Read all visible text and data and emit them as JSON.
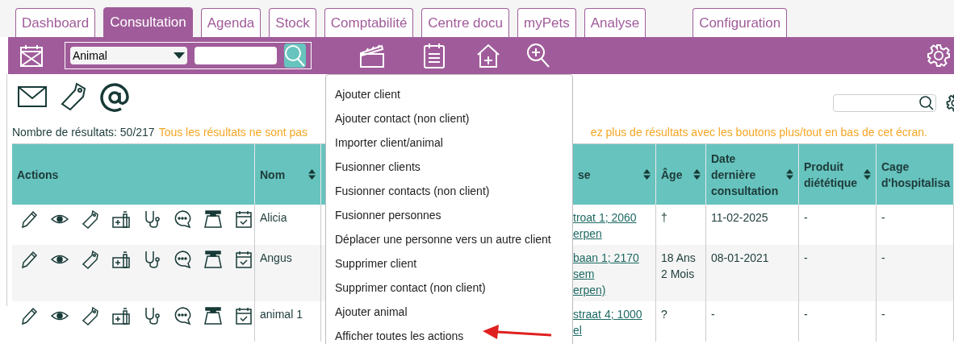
{
  "tabs": [
    {
      "label": "Dashboard",
      "selected": false
    },
    {
      "label": "Consultation",
      "selected": true
    },
    {
      "label": "Agenda",
      "selected": false
    },
    {
      "label": "Stock",
      "selected": false
    },
    {
      "label": "Comptabilité",
      "selected": false
    },
    {
      "label": "Centre docu",
      "selected": false
    },
    {
      "label": "myPets",
      "selected": false
    },
    {
      "label": "Analyse",
      "selected": false
    },
    {
      "label": "Configuration",
      "selected": false
    }
  ],
  "toolbar": {
    "search_type": "Animal"
  },
  "results": {
    "count": "Nombre de résultats: 50/217",
    "warning_left": "Tous les résultats ne sont pas",
    "warning_right": "ez plus de résultats avec les boutons plus/tout en bas de cet écran."
  },
  "table": {
    "columns": [
      {
        "label": "Actions",
        "sortable": false
      },
      {
        "label": "Nom",
        "sortable": true
      },
      {
        "label": "se",
        "sortable": true
      },
      {
        "label": "Âge",
        "sortable": true
      },
      {
        "label": "Date\ndernière\nconsultation",
        "sortable": true
      },
      {
        "label": "Produit\ndiététique",
        "sortable": true
      },
      {
        "label": "Cage\nd'hospitalisa",
        "sortable": false
      }
    ],
    "rows": [
      {
        "name": "Alicia",
        "address": "troat 1; 2060\nerpen",
        "age": "†",
        "last_consultation": "11-02-2025",
        "diet_product": "-",
        "cage": "-"
      },
      {
        "name": "Angus",
        "address": "baan 1; 2170\nsem\nerpen)",
        "age": "18 Ans\n2 Mois",
        "last_consultation": "08-01-2021",
        "diet_product": "-",
        "cage": "-"
      },
      {
        "name": "animal 1",
        "address": "straat 4; 1000\nel",
        "age": "?",
        "last_consultation": "-",
        "diet_product": "-",
        "cage": "-"
      }
    ]
  },
  "menu": {
    "items": [
      "Ajouter client",
      "Ajouter contact (non client)",
      "Importer client/animal",
      "Fusionner clients",
      "Fusionner contacts (non client)",
      "Fusionner personnes",
      "Déplacer une personne vers un autre client",
      "Supprimer client",
      "Supprimer contact (non client)",
      "Ajouter animal",
      "Afficher toutes les actions"
    ]
  }
}
